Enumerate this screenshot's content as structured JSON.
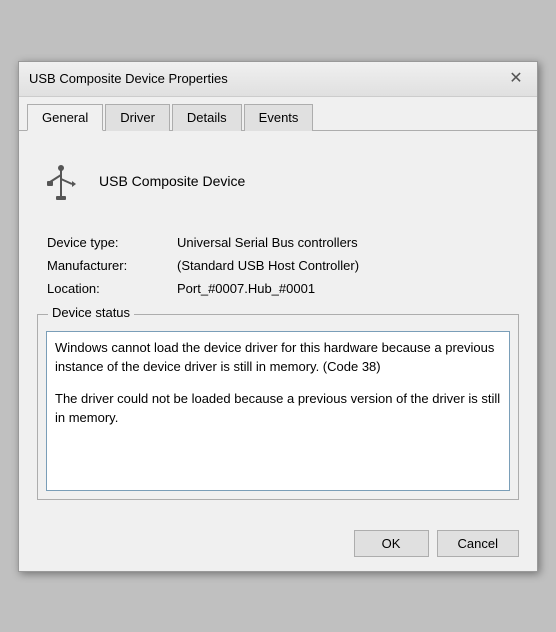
{
  "window": {
    "title": "USB Composite Device Properties",
    "close_label": "✕"
  },
  "tabs": [
    {
      "label": "General",
      "active": true
    },
    {
      "label": "Driver",
      "active": false
    },
    {
      "label": "Details",
      "active": false
    },
    {
      "label": "Events",
      "active": false
    }
  ],
  "device": {
    "name": "USB Composite Device",
    "icon": "usb"
  },
  "info": {
    "rows": [
      {
        "label": "Device type:",
        "value": "Universal Serial Bus controllers"
      },
      {
        "label": "Manufacturer:",
        "value": "(Standard USB Host Controller)"
      },
      {
        "label": "Location:",
        "value": "Port_#0007.Hub_#0001"
      }
    ]
  },
  "status": {
    "section_label": "Device status",
    "line1": "Windows cannot load the device driver for this hardware because a previous instance of the device driver is still in memory. (Code 38)",
    "line2": "The driver could not be loaded because a previous version of the driver is still in memory."
  },
  "buttons": {
    "ok": "OK",
    "cancel": "Cancel"
  }
}
